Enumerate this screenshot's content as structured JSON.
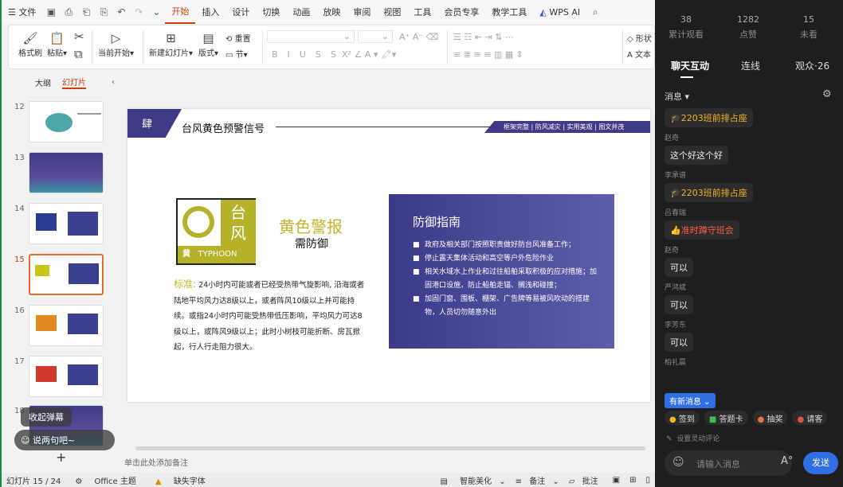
{
  "menubar": {
    "file": "文件",
    "tabs": [
      "开始",
      "插入",
      "设计",
      "切换",
      "动画",
      "放映",
      "审阅",
      "视图",
      "工具",
      "会员专享",
      "教学工具"
    ],
    "wps_ai": "WPS AI"
  },
  "ribbon": {
    "format_painter": "格式刷",
    "paste": "粘贴",
    "start_from": "当前开始",
    "new_slide": "新建幻灯片",
    "layout": "版式",
    "reset": "重置",
    "section": "节",
    "shape": "形状",
    "text": "文本"
  },
  "leftpanel": {
    "outline": "大纲",
    "slides": "幻灯片",
    "thumbs": [
      "12",
      "13",
      "14",
      "15",
      "16",
      "17",
      "18"
    ],
    "collapse": "收起弹幕",
    "say": "说两句吧~",
    "plus": "+"
  },
  "slide": {
    "tag": "肆",
    "title": "台风黄色预警信号",
    "tags": "框架完整 | 防风减灾 | 实用美观 | 图文并茂",
    "sign_char1": "台",
    "sign_char2": "风",
    "sign_yellow": "黄",
    "sign_typhoon": "TYPHOON",
    "alert": "黄色警报",
    "need": "需防御",
    "std_label": "标准:",
    "std_text": "24小时内可能或者已经受热带气旋影响, 沿海或者陆地平均风力达8级以上，或者阵风10级以上并可能持续。或指24小时内可能受热带低压影响，平均风力可达8级以上，或阵风9级以上；此时小树枝可能折断、房瓦掀起，行人行走阻力很大。",
    "guide_title": "防御指南",
    "guide": [
      "政府及相关部门按照职责做好防台风准备工作；",
      "停止露天集体活动和高空等户外危险作业",
      "相关水域水上作业和过往船舶采取积极的应对措施；加固港口设施，防止船舶走锚、搁浅和碰撞；",
      "加固门窗、围板、棚架、广告牌等易被风吹动的搭建物，人员切勿随意外出"
    ]
  },
  "notes": "单击此处添加备注",
  "status": {
    "slide": "幻灯片 15 / 24",
    "theme": "Office 主题",
    "font": "缺失字体",
    "smart": "智能美化",
    "notes": "备注",
    "comment": "批注"
  },
  "right": {
    "stats": [
      {
        "n": "38",
        "l": "累计观看"
      },
      {
        "n": "1282",
        "l": "点赞"
      },
      {
        "n": "15",
        "l": "未看"
      }
    ],
    "tabs": [
      "聊天互动",
      "连线",
      "观众·26"
    ],
    "msg_header": "消息",
    "messages": [
      {
        "name": "",
        "text": "2203班前排占座",
        "style": "gold"
      },
      {
        "name": "赵奇",
        "text": "这个好这个好",
        "style": ""
      },
      {
        "name": "李承谱",
        "text": "2203班前排占座",
        "style": "gold"
      },
      {
        "name": "吕春瑞",
        "text": "准时蹲守班会",
        "style": "red"
      },
      {
        "name": "赵奇",
        "text": "可以",
        "style": ""
      },
      {
        "name": "严鸿斌",
        "text": "可以",
        "style": ""
      },
      {
        "name": "李芳东",
        "text": "可以",
        "style": ""
      },
      {
        "name": "柏礼晨",
        "text": "",
        "style": ""
      }
    ],
    "new_msg": "有新消息",
    "actions": [
      "签到",
      "答题卡",
      "抽奖",
      "请客"
    ],
    "setting": "设置灵动评论",
    "input_placeholder": "请输入消息",
    "send": "发送"
  }
}
